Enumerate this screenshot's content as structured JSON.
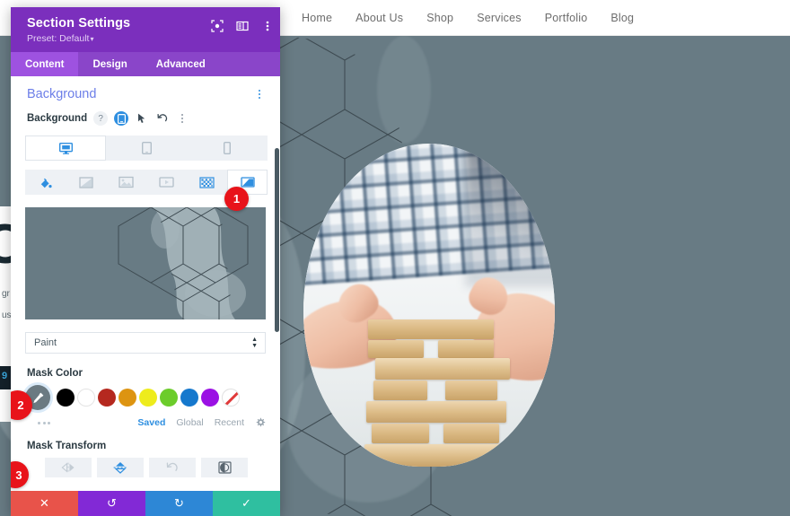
{
  "site": {
    "nav": [
      {
        "label": "Home"
      },
      {
        "label": "About Us"
      },
      {
        "label": "Shop"
      },
      {
        "label": "Services"
      },
      {
        "label": "Portfolio"
      },
      {
        "label": "Blog"
      }
    ],
    "hero": {
      "base_color": "#687b84",
      "pattern_color": "#a6b6bb",
      "mask_pattern": "hexagon-grid"
    },
    "left_peek": {
      "glyph": "C",
      "line_1": "gr",
      "line_2": "us",
      "badge_text": "9"
    }
  },
  "panel": {
    "title": "Section Settings",
    "preset_label": "Preset: Default",
    "preset_caret": "▾",
    "header_icons": [
      {
        "name": "focus-target-icon"
      },
      {
        "name": "layout-panel-icon"
      },
      {
        "name": "more-options-icon"
      }
    ],
    "tabs": [
      {
        "label": "Content",
        "active": true
      },
      {
        "label": "Design",
        "active": false
      },
      {
        "label": "Advanced",
        "active": false
      }
    ],
    "section": {
      "title": "Background",
      "options_icon": "kebab-vertical-icon"
    },
    "background_field": {
      "label": "Background",
      "help_icon": "?",
      "responsive_icon": "responsive-device-icon",
      "hover_icon": "cursor-pointer-icon",
      "reset_icon": "undo-reset-icon",
      "more_icon": "kebab-vertical-icon"
    },
    "device_tabs": [
      {
        "name": "desktop",
        "icon": "desktop-icon",
        "active": true
      },
      {
        "name": "tablet",
        "icon": "tablet-icon",
        "active": false
      },
      {
        "name": "phone",
        "icon": "phone-icon",
        "active": false
      }
    ],
    "background_types": [
      {
        "name": "color",
        "icon": "paint-bucket-icon",
        "active": false,
        "accent": true
      },
      {
        "name": "gradient",
        "icon": "gradient-icon",
        "active": false,
        "accent": false
      },
      {
        "name": "image",
        "icon": "image-icon",
        "active": false,
        "accent": false
      },
      {
        "name": "video",
        "icon": "video-icon",
        "active": false,
        "accent": false
      },
      {
        "name": "pattern",
        "icon": "pattern-icon",
        "active": false,
        "accent": true
      },
      {
        "name": "mask",
        "icon": "mask-icon",
        "active": true,
        "accent": true
      }
    ],
    "mask_select": {
      "label": "Paint",
      "value": "Paint"
    },
    "mask_color": {
      "label": "Mask Color",
      "eyedropper_icon": "eyedropper-icon",
      "swatches": [
        {
          "name": "black",
          "hex": "#000000"
        },
        {
          "name": "white",
          "hex": "#ffffff"
        },
        {
          "name": "dark-red",
          "hex": "#b5281f"
        },
        {
          "name": "orange",
          "hex": "#dd9411"
        },
        {
          "name": "yellow",
          "hex": "#eeec1c"
        },
        {
          "name": "green",
          "hex": "#6ccc2b"
        },
        {
          "name": "blue",
          "hex": "#1578cd"
        },
        {
          "name": "purple",
          "hex": "#9b10e4"
        },
        {
          "name": "transparent",
          "hex": "none"
        }
      ],
      "more_icon": "ellipsis-icon",
      "source_tabs": [
        {
          "label": "Saved",
          "active": true
        },
        {
          "label": "Global",
          "active": false
        },
        {
          "label": "Recent",
          "active": false
        }
      ],
      "settings_icon": "gear-icon"
    },
    "mask_transform": {
      "label": "Mask Transform",
      "buttons": [
        {
          "name": "flip-horizontal",
          "icon": "flip-horizontal-icon",
          "active": false
        },
        {
          "name": "flip-vertical",
          "icon": "flip-vertical-icon",
          "active": true
        },
        {
          "name": "rotate",
          "icon": "rotate-icon",
          "active": false
        },
        {
          "name": "invert",
          "icon": "invert-icon",
          "active": false
        }
      ]
    },
    "footer_actions": [
      {
        "name": "cancel",
        "icon": "✕",
        "color": "#e8534a"
      },
      {
        "name": "undo",
        "icon": "↺",
        "color": "#8229d6"
      },
      {
        "name": "redo",
        "icon": "↻",
        "color": "#2d87d6"
      },
      {
        "name": "save",
        "icon": "✓",
        "color": "#2fbfa0"
      }
    ],
    "scrollbar": {
      "name": "panel-scrollbar"
    }
  },
  "callouts": [
    {
      "id": "badge-1",
      "label": "1"
    },
    {
      "id": "badge-2",
      "label": "2"
    },
    {
      "id": "badge-3",
      "label": "3"
    }
  ]
}
